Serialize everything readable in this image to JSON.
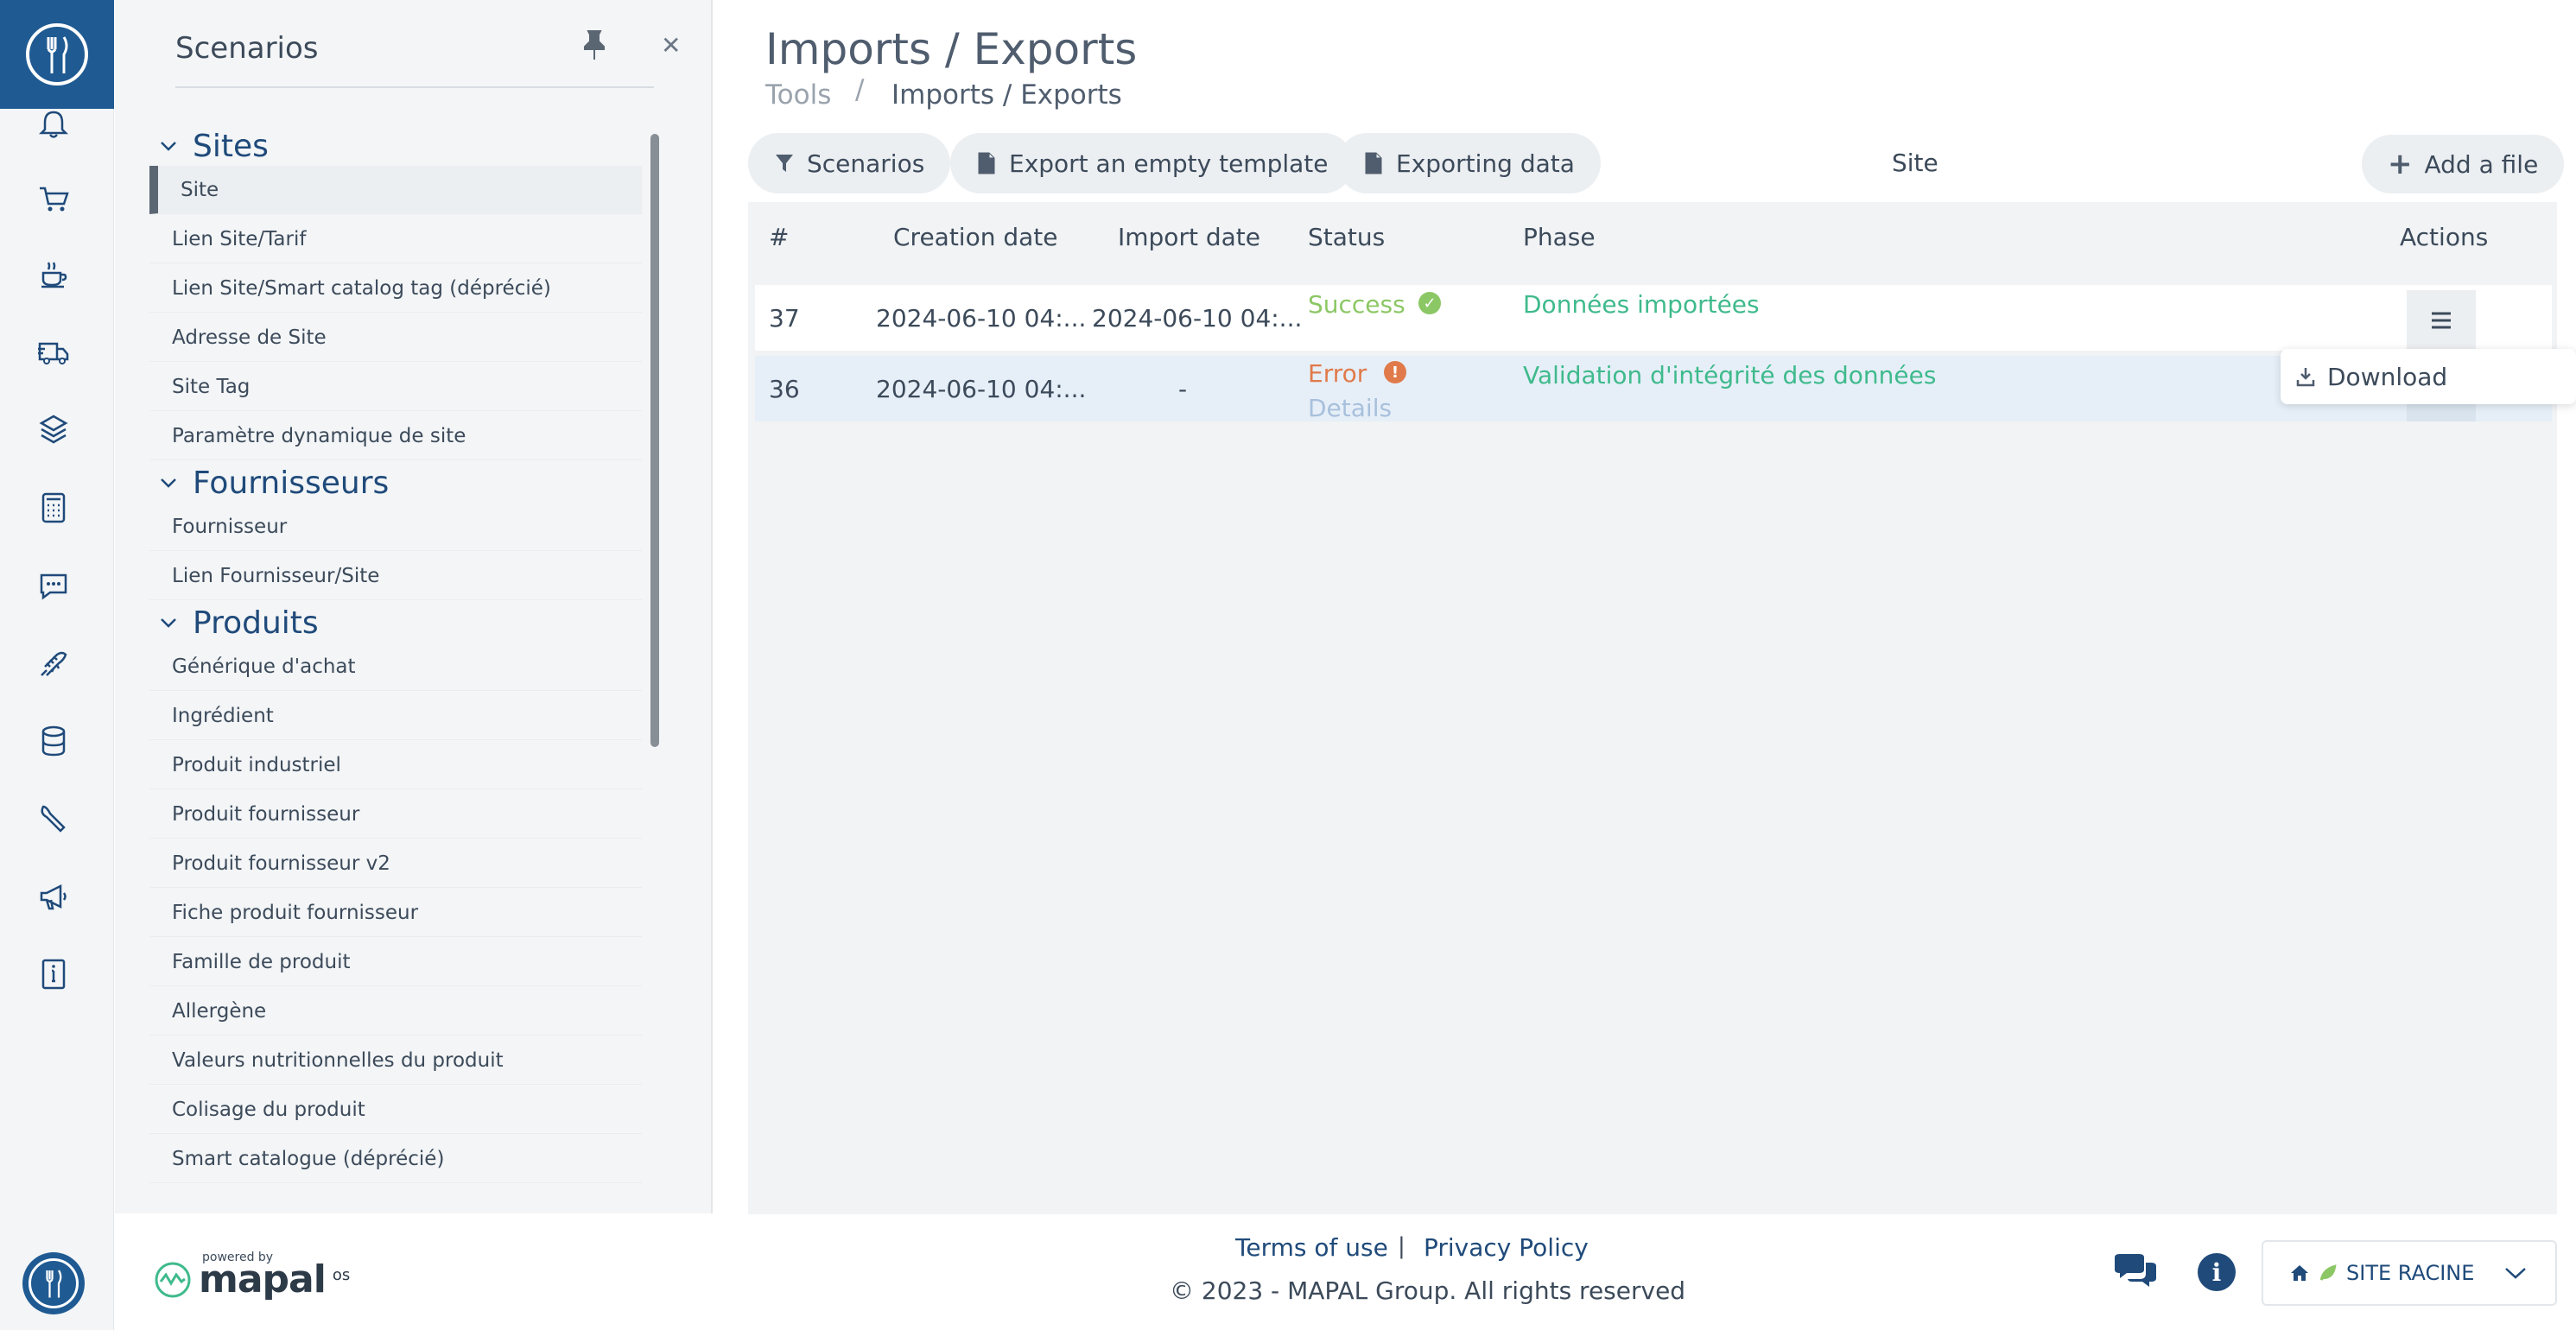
{
  "sidebar_panel": {
    "title": "Scenarios",
    "groups": [
      {
        "label": "Sites",
        "items": [
          "Site",
          "Lien Site/Tarif",
          "Lien Site/Smart catalog tag (déprécié)",
          "Adresse de Site",
          "Site Tag",
          "Paramètre dynamique de site"
        ]
      },
      {
        "label": "Fournisseurs",
        "items": [
          "Fournisseur",
          "Lien Fournisseur/Site"
        ]
      },
      {
        "label": "Produits",
        "items": [
          "Générique d'achat",
          "Ingrédient",
          "Produit industriel",
          "Produit fournisseur",
          "Produit fournisseur v2",
          "Fiche produit fournisseur",
          "Famille de produit",
          "Allergène",
          "Valeurs nutritionnelles du produit",
          "Colisage du produit",
          "Smart catalogue (déprécié)"
        ]
      }
    ],
    "active_item": "Site"
  },
  "page": {
    "title": "Imports / Exports",
    "breadcrumb": {
      "root": "Tools",
      "separator": "/",
      "current": "Imports / Exports"
    }
  },
  "toolbar": {
    "scenarios_label": "Scenarios",
    "export_template_label": "Export an empty template",
    "exporting_data_label": "Exporting data",
    "current_scenario": "Site",
    "add_file_label": "Add a file"
  },
  "table": {
    "headers": [
      "#",
      "Creation date",
      "Import date",
      "Status",
      "Phase",
      "Actions"
    ],
    "rows": [
      {
        "id": "37",
        "creation_date": "2024-06-10 04:...",
        "import_date": "2024-06-10 04:...",
        "status": "Success",
        "phase": "Données importées"
      },
      {
        "id": "36",
        "creation_date": "2024-06-10 04:...",
        "import_date": "-",
        "status": "Error",
        "details": "Details",
        "phase": "Validation d'intégrité des données"
      }
    ]
  },
  "dropdown": {
    "download_label": "Download"
  },
  "footer": {
    "powered_by": "powered by",
    "brand": "mapal",
    "brand_suffix": "os",
    "terms_label": "Terms of use",
    "separator": "|",
    "privacy_label": "Privacy Policy",
    "copyright": "© 2023 - MAPAL Group. All rights reserved",
    "site_selector": "SITE RACINE"
  },
  "colors": {
    "brand_blue": "#1f5a92",
    "success": "#8cc765",
    "error": "#e07a4a",
    "phase": "#3fba8c"
  },
  "icons": [
    "bell-icon",
    "cart-icon",
    "coffee-icon",
    "truck-icon",
    "layers-icon",
    "calculator-icon",
    "chat-icon",
    "fish-icon",
    "database-icon",
    "wrench-icon",
    "megaphone-icon",
    "info-doc-icon"
  ]
}
